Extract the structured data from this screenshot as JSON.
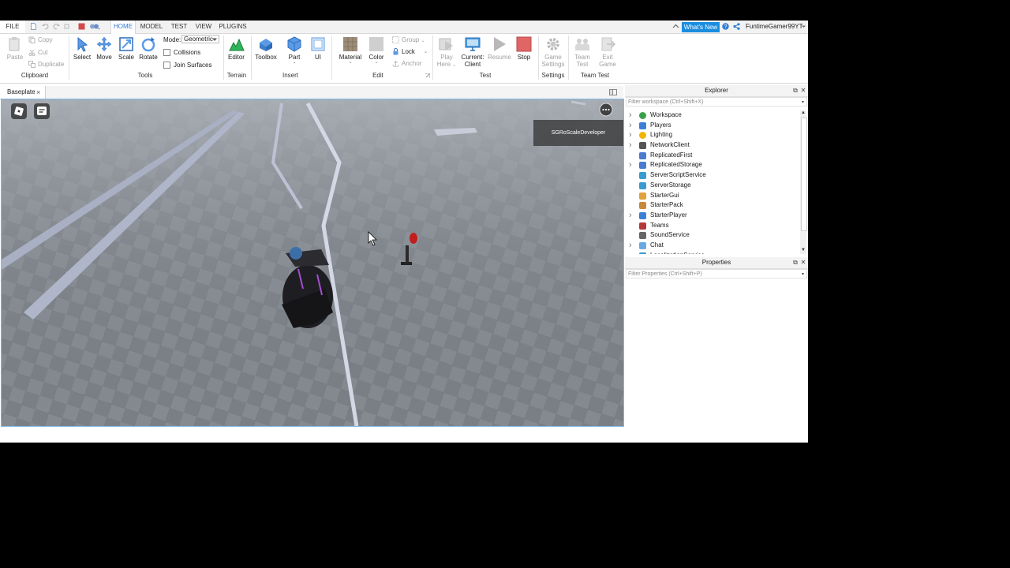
{
  "menu": {
    "file": "FILE",
    "tabs": [
      "HOME",
      "MODEL",
      "TEST",
      "VIEW",
      "PLUGINS"
    ],
    "active_tab": "HOME",
    "whats_new": "What's New",
    "username": "FuntimeGamer99YT"
  },
  "ribbon": {
    "clipboard": {
      "label": "Clipboard",
      "paste": "Paste",
      "copy": "Copy",
      "cut": "Cut",
      "duplicate": "Duplicate"
    },
    "tools": {
      "label": "Tools",
      "select": "Select",
      "move": "Move",
      "scale": "Scale",
      "rotate": "Rotate",
      "mode_label": "Mode:",
      "mode_value": "Geometric",
      "collisions": "Collisions",
      "join_surfaces": "Join Surfaces"
    },
    "terrain": {
      "label": "Terrain",
      "editor": "Editor"
    },
    "insert": {
      "label": "Insert",
      "toolbox": "Toolbox",
      "part": "Part",
      "ui": "UI"
    },
    "edit": {
      "label": "Edit",
      "material": "Material",
      "color": "Color",
      "group": "Group",
      "lock": "Lock",
      "anchor": "Anchor"
    },
    "test": {
      "label": "Test",
      "play_here_1": "Play",
      "play_here_2": "Here",
      "current_client_1": "Current:",
      "current_client_2": "Client",
      "resume": "Resume",
      "stop": "Stop"
    },
    "settings": {
      "label": "Settings",
      "game_settings_1": "Game",
      "game_settings_2": "Settings"
    },
    "team_test": {
      "label": "Team Test",
      "team_test_1": "Team",
      "team_test_2": "Test",
      "exit_game_1": "Exit",
      "exit_game_2": "Game"
    }
  },
  "document": {
    "tab": "Baseplate"
  },
  "viewport": {
    "player_name": "SGRoScaleDeveloper"
  },
  "explorer": {
    "title": "Explorer",
    "filter_placeholder": "Filter workspace (Ctrl+Shift+X)",
    "items": [
      {
        "label": "Workspace",
        "expandable": true,
        "icon": "workspace-icon",
        "color": "#3aa04a"
      },
      {
        "label": "Players",
        "expandable": true,
        "icon": "players-icon",
        "color": "#3d7fd6"
      },
      {
        "label": "Lighting",
        "expandable": true,
        "icon": "lighting-icon",
        "color": "#f0b400"
      },
      {
        "label": "NetworkClient",
        "expandable": true,
        "icon": "network-client-icon",
        "color": "#555555"
      },
      {
        "label": "ReplicatedFirst",
        "expandable": false,
        "icon": "replicated-first-icon",
        "color": "#4a7bd0"
      },
      {
        "label": "ReplicatedStorage",
        "expandable": true,
        "icon": "replicated-storage-icon",
        "color": "#4a7bd0"
      },
      {
        "label": "ServerScriptService",
        "expandable": false,
        "icon": "server-script-service-icon",
        "color": "#3a9bd0"
      },
      {
        "label": "ServerStorage",
        "expandable": false,
        "icon": "server-storage-icon",
        "color": "#3a9bd0"
      },
      {
        "label": "StarterGui",
        "expandable": false,
        "icon": "starter-gui-icon",
        "color": "#e0a23a"
      },
      {
        "label": "StarterPack",
        "expandable": false,
        "icon": "starter-pack-icon",
        "color": "#c9893a"
      },
      {
        "label": "StarterPlayer",
        "expandable": true,
        "icon": "starter-player-icon",
        "color": "#3d7fd6"
      },
      {
        "label": "Teams",
        "expandable": false,
        "icon": "teams-icon",
        "color": "#b43a3a"
      },
      {
        "label": "SoundService",
        "expandable": false,
        "icon": "sound-service-icon",
        "color": "#666666"
      },
      {
        "label": "Chat",
        "expandable": true,
        "icon": "chat-icon",
        "color": "#6aa9e0"
      },
      {
        "label": "LocalizationService",
        "expandable": false,
        "icon": "localization-service-icon",
        "color": "#3a9bd0"
      }
    ]
  },
  "properties": {
    "title": "Properties",
    "filter_placeholder": "Filter Properties (Ctrl+Shift+P)"
  }
}
